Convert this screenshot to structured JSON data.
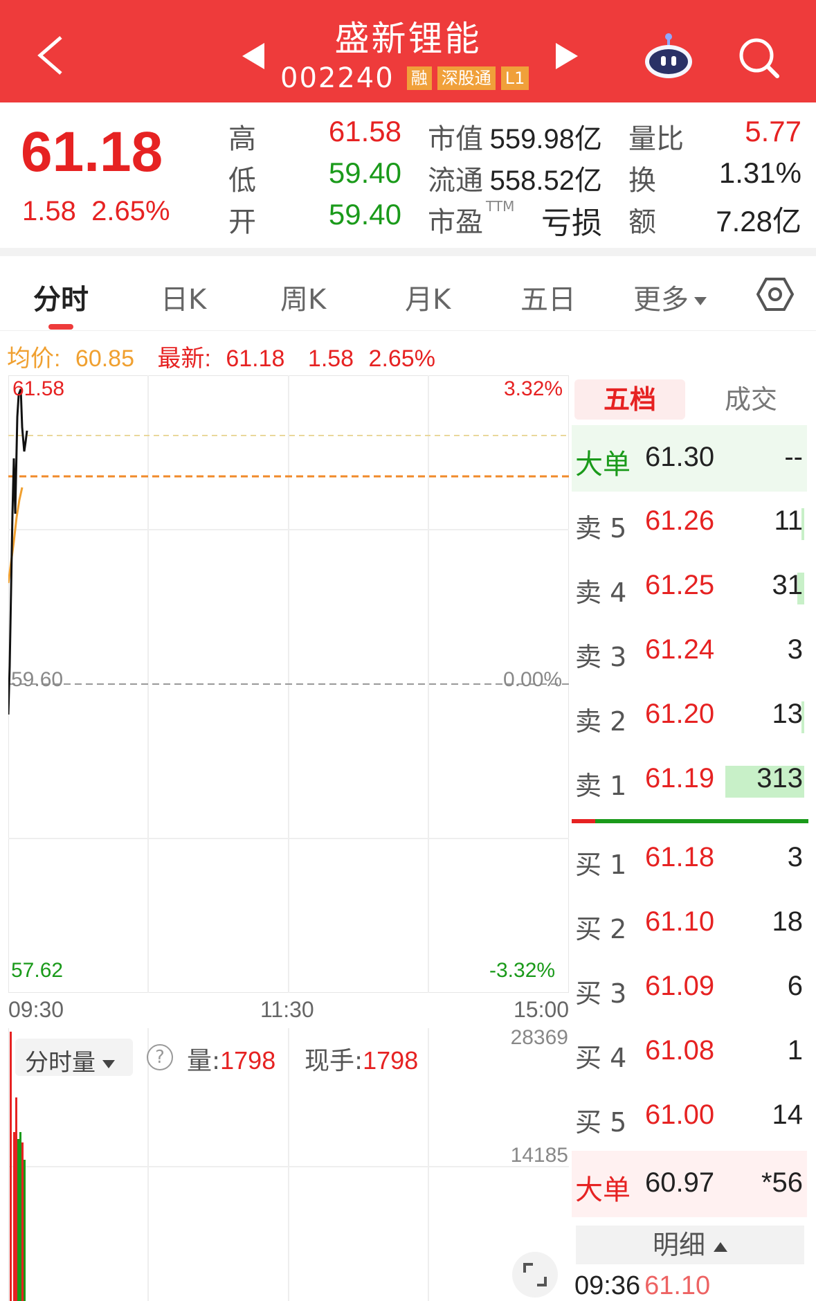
{
  "header": {
    "stock_name": "盛新锂能",
    "stock_code": "002240",
    "tags": [
      "融",
      "深股通",
      "L1"
    ],
    "icons": [
      "back-arrow-icon",
      "prev-stock-icon",
      "next-stock-icon",
      "robot-assistant-icon",
      "search-icon"
    ]
  },
  "quote": {
    "price": "61.18",
    "change": "1.58",
    "change_pct": "2.65%",
    "high_label": "高",
    "high": "61.58",
    "low_label": "低",
    "low": "59.40",
    "open_label": "开",
    "open": "59.40",
    "mktcap_label": "市值",
    "mktcap": "559.98亿",
    "float_label": "流通",
    "float_cap": "558.52亿",
    "pe_label": "市盈",
    "pe_sup": "TTM",
    "pe": "亏损",
    "volratio_label": "量比",
    "volratio": "5.77",
    "turnover_label": "换",
    "turnover": "1.31%",
    "amount_label": "额",
    "amount": "7.28亿",
    "colors": {
      "up": "#e62222",
      "down": "#1a9a1a",
      "header": "#ee3b3b"
    }
  },
  "tabs": {
    "items": [
      "分时",
      "日K",
      "周K",
      "月K",
      "五日",
      "更多"
    ],
    "active": "分时"
  },
  "info": {
    "avg_label": "均价:",
    "avg": "60.85",
    "latest_label": "最新:",
    "latest": "61.18",
    "change": "1.58",
    "change_pct": "2.65%"
  },
  "chart": {
    "y_top": "61.58",
    "y_mid": "59.60",
    "y_bot": "57.62",
    "pct_top": "3.32%",
    "pct_mid": "0.00%",
    "pct_bot": "-3.32%",
    "t_start": "09:30",
    "t_mid": "11:30",
    "t_end": "15:00"
  },
  "volume": {
    "selector": "分时量",
    "help": "?",
    "vol_label": "量:",
    "vol": "1798",
    "now_label": "现手:",
    "now": "1798",
    "axis_top": "28369",
    "axis_mid": "14185"
  },
  "orderbook": {
    "tab_active": "五档",
    "tab_other": "成交",
    "big_top": {
      "label": "大单",
      "price": "61.30",
      "vol": "--"
    },
    "asks": [
      {
        "label": "卖 5",
        "price": "61.26",
        "vol": "11"
      },
      {
        "label": "卖 4",
        "price": "61.25",
        "vol": "31"
      },
      {
        "label": "卖 3",
        "price": "61.24",
        "vol": "3"
      },
      {
        "label": "卖 2",
        "price": "61.20",
        "vol": "13"
      },
      {
        "label": "卖 1",
        "price": "61.19",
        "vol": "313"
      }
    ],
    "bids": [
      {
        "label": "买 1",
        "price": "61.18",
        "vol": "3"
      },
      {
        "label": "买 2",
        "price": "61.10",
        "vol": "18"
      },
      {
        "label": "买 3",
        "price": "61.09",
        "vol": "6"
      },
      {
        "label": "买 4",
        "price": "61.08",
        "vol": "1"
      },
      {
        "label": "买 5",
        "price": "61.00",
        "vol": "14"
      }
    ],
    "big_bottom": {
      "label": "大单",
      "price": "60.97",
      "vol": "*56"
    },
    "detail": "明细",
    "last_tick_time": "09:36",
    "last_tick_price": "61.10"
  }
}
